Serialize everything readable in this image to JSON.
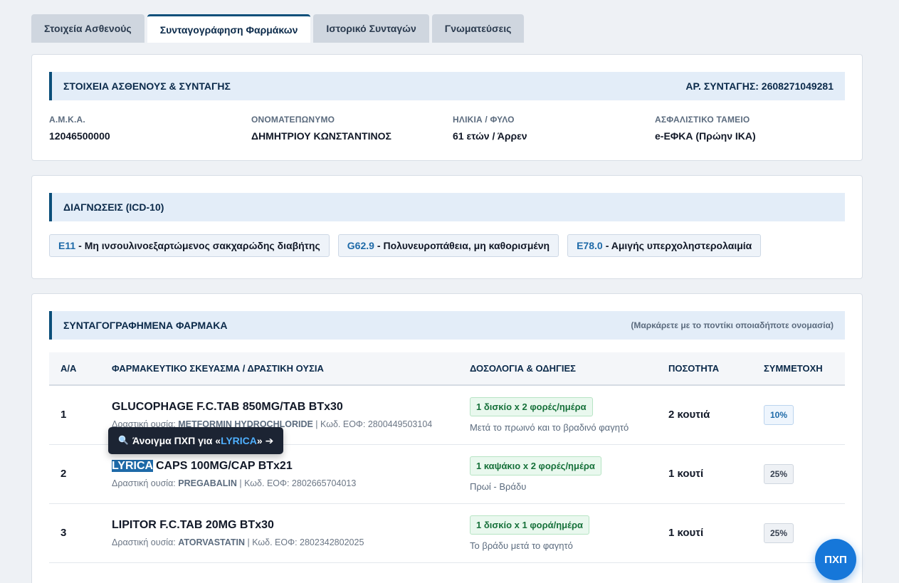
{
  "tabs": [
    "Στοιχεία Ασθενούς",
    "Συνταγογράφηση Φαρμάκων",
    "Ιστορικό Συνταγών",
    "Γνωματεύσεις"
  ],
  "patient_section": {
    "title": "ΣΤΟΙΧΕΙΑ ΑΣΘΕΝΟΥΣ & ΣΥΝΤΑΓΗΣ",
    "rx_number": "ΑΡ. ΣΥΝΤΑΓΗΣ: 2608271049281",
    "fields": [
      {
        "label": "Α.Μ.Κ.Α.",
        "value": "12046500000"
      },
      {
        "label": "ΟΝΟΜΑΤΕΠΩΝΥΜΟ",
        "value": "ΔΗΜΗΤΡΙΟΥ ΚΩΝΣΤΑΝΤΙΝΟΣ"
      },
      {
        "label": "ΗΛΙΚΙΑ / ΦΥΛΟ",
        "value": "61 ετών / Άρρεν"
      },
      {
        "label": "ΑΣΦΑΛΙΣΤΙΚΟ ΤΑΜΕΙΟ",
        "value": "e-ΕΦΚΑ (Πρώην ΙΚΑ)"
      }
    ]
  },
  "diagnoses_section": {
    "title": "ΔΙΑΓΝΩΣΕΙΣ (ICD-10)",
    "items": [
      {
        "code": "E11",
        "text": "- Μη ινσουλινοεξαρτώμενος σακχαρώδης διαβήτης"
      },
      {
        "code": "G62.9",
        "text": "- Πολυνευροπάθεια, μη καθορισμένη"
      },
      {
        "code": "E78.0",
        "text": "- Αμιγής υπερχοληστερολαιμία"
      }
    ]
  },
  "drugs_section": {
    "title": "ΣΥΝΤΑΓΟΓΡΑΦΗΜΕΝΑ ΦΑΡΜΑΚΑ",
    "hint": "(Μαρκάρετε με το ποντίκι οποιαδήποτε ονομασία)",
    "headers": [
      "Α/Α",
      "ΦΑΡΜΑΚΕΥΤΙΚΟ ΣΚΕΥΑΣΜΑ / ΔΡΑΣΤΙΚΗ ΟΥΣΙΑ",
      "ΔΟΣΟΛΟΓΙΑ & ΟΔΗΓΙΕΣ",
      "ΠΟΣΟΤΗΤΑ",
      "ΣΥΜΜΕΤΟΧΗ"
    ],
    "rows": [
      {
        "aa": "1",
        "name": "GLUCOPHAGE F.C.TAB 850MG/TAB BTx30",
        "sub_prefix": "Δραστική ουσία: ",
        "substance": "METFORMIN HYDROCHLORIDE",
        "sub_suffix": " | Κωδ. ΕΟΦ: 2800449503104",
        "dose": "1 δισκίο x 2 φορές/ημέρα",
        "note": "Μετά το πρωινό και το βραδινό φαγητό",
        "qty": "2 κουτιά",
        "pct": "10%"
      },
      {
        "aa": "2",
        "name_hl": "LYRICA",
        "name_rest": " CAPS 100MG/CAP BTx21",
        "sub_prefix": "Δραστική ουσία: ",
        "substance": "PREGABALIN",
        "sub_suffix": " | Κωδ. ΕΟΦ: 2802665704013",
        "dose": "1 καψάκιο x 2 φορές/ημέρα",
        "note": "Πρωί - Βράδυ",
        "qty": "1 κουτί",
        "pct": "25%"
      },
      {
        "aa": "3",
        "name": "LIPITOR F.C.TAB 20MG BTx30",
        "sub_prefix": "Δραστική ουσία: ",
        "substance": "ATORVASTATIN",
        "sub_suffix": " | Κωδ. ΕΟΦ: 2802342802025",
        "dose": "1 δισκίο x 1 φορά/ημέρα",
        "note": "Το βράδυ μετά το φαγητό",
        "qty": "1 κουτί",
        "pct": "25%"
      }
    ]
  },
  "tooltip": {
    "prefix": "Άνοιγμα ΠΧΠ για «",
    "term": "LYRICA",
    "suffix": "» ➔",
    "icon": "magnifier-icon"
  },
  "fab": {
    "label": "ΠΧΠ"
  },
  "colors": {
    "accent": "#0b4f7a",
    "fab": "#1677d9",
    "dose_green": "#16713a"
  }
}
